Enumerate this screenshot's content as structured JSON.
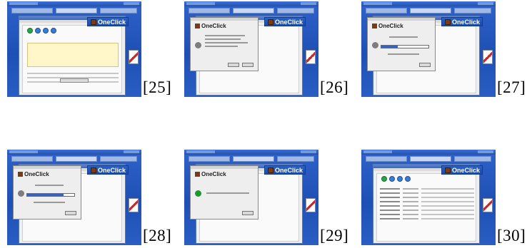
{
  "screenshots": [
    {
      "id": "25",
      "caption": "[25]",
      "brand": "OneClick",
      "variant": "details"
    },
    {
      "id": "26",
      "caption": "[26]",
      "brand": "OneClick",
      "variant": "confirm"
    },
    {
      "id": "27",
      "caption": "[27]",
      "brand": "OneClick",
      "variant": "downloading",
      "progress": 0.35
    },
    {
      "id": "28",
      "caption": "[28]",
      "brand": "OneClick",
      "variant": "downloading",
      "progress": 0.78
    },
    {
      "id": "29",
      "caption": "[29]",
      "brand": "OneClick",
      "variant": "done"
    },
    {
      "id": "30",
      "caption": "[30]",
      "brand": "OneClick",
      "variant": "list"
    }
  ]
}
